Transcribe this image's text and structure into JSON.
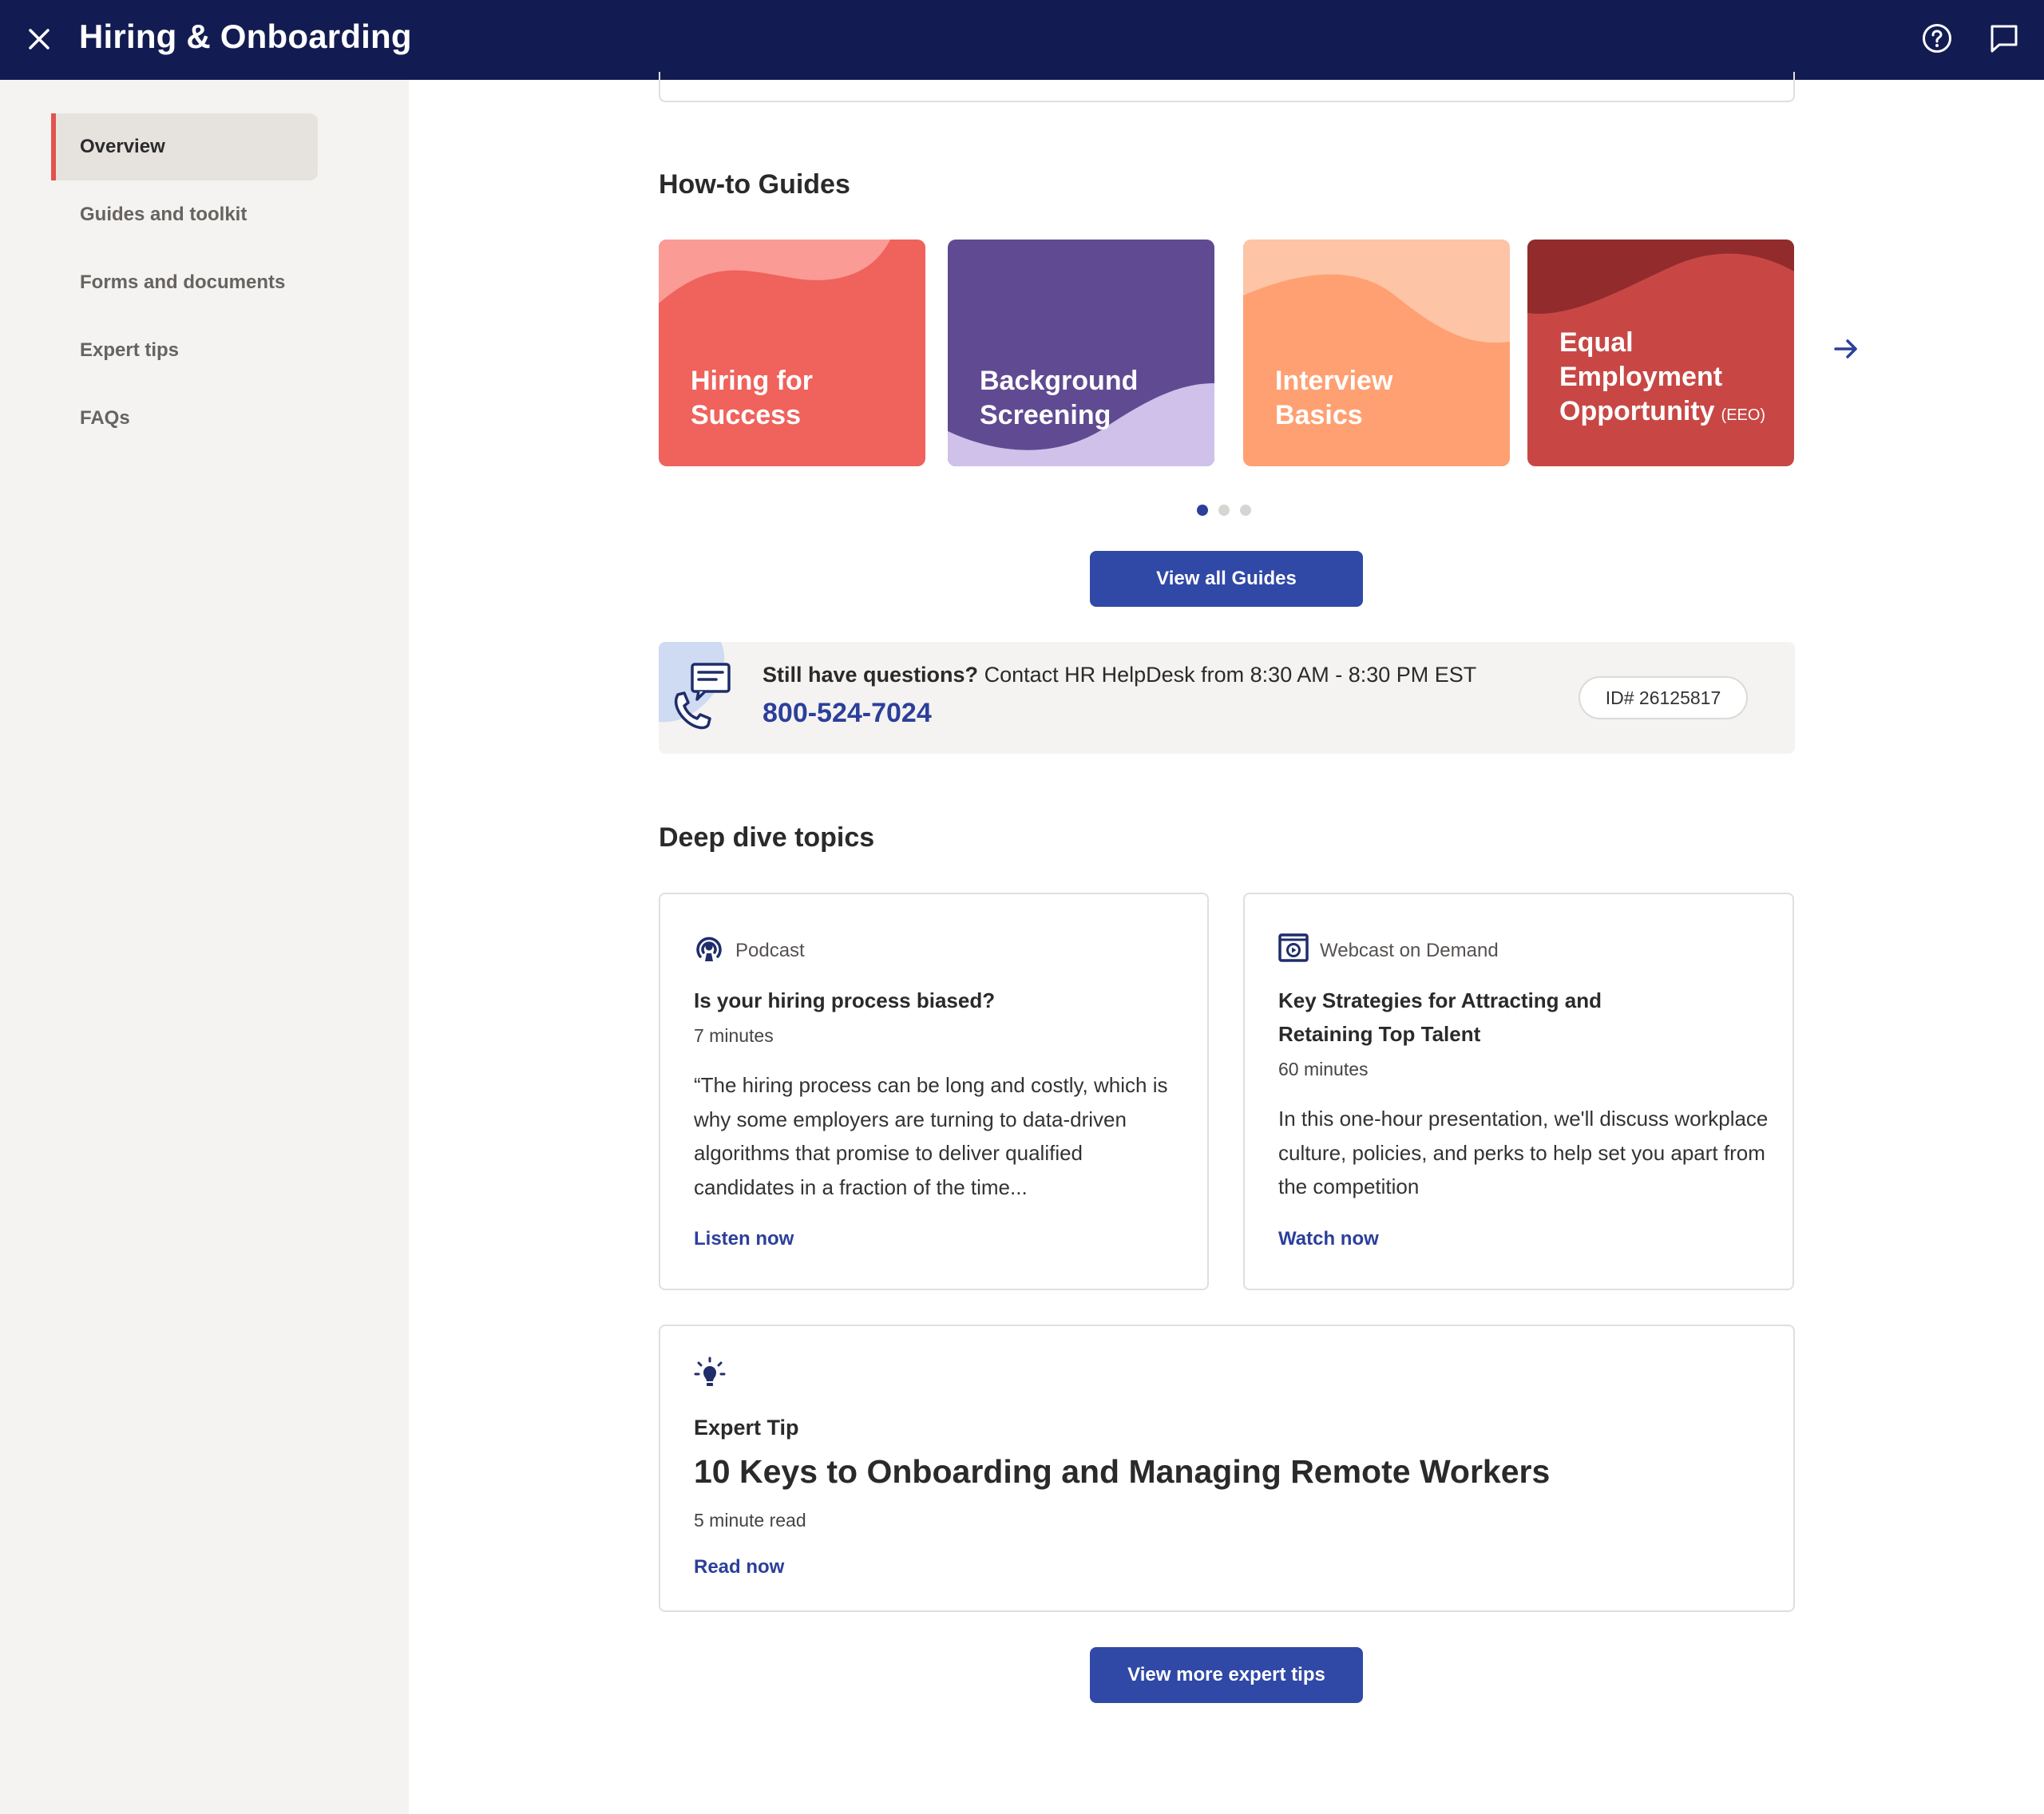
{
  "header": {
    "title": "Hiring & Onboarding",
    "close_icon": "close-icon",
    "help_icon": "help-circle-icon",
    "chat_icon": "chat-bubble-icon",
    "bg_color": "#131c52"
  },
  "sidebar": {
    "items": [
      {
        "label": "Overview",
        "active": true
      },
      {
        "label": "Guides and toolkit",
        "active": false
      },
      {
        "label": "Forms and documents",
        "active": false
      },
      {
        "label": "Expert tips",
        "active": false
      },
      {
        "label": "FAQs",
        "active": false
      }
    ],
    "accent_color": "#e3524e"
  },
  "howto": {
    "title": "How-to Guides",
    "cards": [
      {
        "line1": "Hiring for",
        "line2": "Success",
        "color": "#f0625c"
      },
      {
        "line1": "Background",
        "line2": "Screening",
        "color": "#604a92"
      },
      {
        "line1": "Interview",
        "line2": "Basics",
        "color": "#ffa072"
      },
      {
        "line1": "Equal",
        "line2": "Employment",
        "line3": "Opportunity",
        "suffix": "(EEO)",
        "color": "#c84744"
      }
    ],
    "next_icon": "arrow-right-icon",
    "pagination": {
      "total": 3,
      "current": 1
    },
    "view_all_label": "View all Guides"
  },
  "helpdesk": {
    "question_bold": "Still have questions?",
    "question_rest": " Contact HR HelpDesk from 8:30 AM - 8:30 PM EST",
    "phone": "800-524-7024",
    "id_label": "ID# 26125817",
    "icon": "chat-phone-icon"
  },
  "deep_dive": {
    "title": "Deep dive topics",
    "cards": [
      {
        "kind": "Podcast",
        "icon": "podcast-icon",
        "title": "Is your hiring process biased?",
        "duration": "7 minutes",
        "description": "“The hiring process can be long and costly, which is why some employers are turning to data-driven algorithms that promise to deliver qualified candidates in a fraction of the time...",
        "cta": "Listen now"
      },
      {
        "kind": "Webcast on Demand",
        "icon": "webcast-play-icon",
        "title": "Key Strategies for Attracting and Retaining Top Talent",
        "duration": "60 minutes",
        "description": "In this one-hour presentation, we'll discuss workplace culture, policies, and perks to help set you apart from the competition",
        "cta": "Watch now"
      }
    ]
  },
  "expert_tip": {
    "icon": "lightbulb-icon",
    "label": "Expert Tip",
    "title": "10 Keys to Onboarding and Managing Remote Workers",
    "read_time": "5 minute read",
    "cta": "Read now",
    "more_label": "View more expert tips"
  },
  "colors": {
    "primary_button": "#3048a6",
    "link": "#2c3f9a"
  }
}
